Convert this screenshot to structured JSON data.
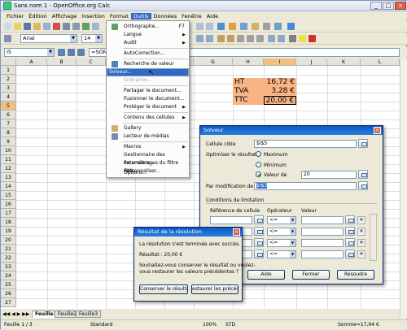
{
  "window": {
    "title": "Sans nom 1 - OpenOffice.org Calc"
  },
  "menubar": [
    "Fichier",
    "Édition",
    "Affichage",
    "Insertion",
    "Format",
    "Outils",
    "Données",
    "Fenêtre",
    "Aide"
  ],
  "toolbar": {
    "font_name": "Arial",
    "font_size": "14",
    "cell_ref": "I5",
    "formula_text": "=SOMM"
  },
  "columns": [
    "A",
    "B",
    "C",
    "D",
    "E",
    "F",
    "G",
    "H",
    "I",
    "J",
    "K",
    "L"
  ],
  "rows": [
    "1",
    "2",
    "3",
    "4",
    "5",
    "6",
    "7",
    "8",
    "9",
    "10",
    "11",
    "12",
    "13",
    "14",
    "15",
    "16",
    "17",
    "18",
    "19",
    "20",
    "21",
    "22",
    "23",
    "24",
    "25",
    "26",
    "27"
  ],
  "cells": {
    "h3": "HT",
    "i3": "16,72 €",
    "h4": "TVA",
    "i4": "3,28 €",
    "h5": "TTC",
    "i5": "20,00 €"
  },
  "outils_menu": {
    "orthographe": "Orthographe...",
    "orthographe_shortcut": "F7",
    "langue": "Langue",
    "audit": "Audit",
    "autocorrection": "AutoCorrection...",
    "recherche": "Recherche de valeur cible...",
    "solveur": "Solveur...",
    "scenarios": "Scénarios...",
    "partager": "Partager le document...",
    "fusionner": "Fusionner le document...",
    "proteger": "Protéger le document",
    "contenu": "Contenu des cellules",
    "gallery": "Gallery",
    "lecteur": "Lecteur de médias",
    "macros": "Macros",
    "gestionnaire": "Gestionnaire des extensions...",
    "parametrages": "Paramétrages du filtre XML...",
    "personnaliser": "Personnaliser...",
    "options": "Options..."
  },
  "solveur_dialog": {
    "title": "Solveur",
    "cellule_cible_label": "Cellule cible",
    "cellule_cible_value": "$I$5",
    "optimiser_label": "Optimiser le résultat à",
    "maximum": "Maximum",
    "minimum": "Minimum",
    "valeur_de": "Valeur de",
    "valeur_value": "20",
    "par_modification": "Par modification de cel",
    "par_modification_value": "$I$3",
    "conditions_label": "Conditions de limitation",
    "reference_col": "Référence de cellule",
    "operateur_col": "Opérateur",
    "valeur_col": "Valeur",
    "operator_value": "<=",
    "aide": "Aide",
    "fermer": "Fermer",
    "resoudre": "Résoudre"
  },
  "result_dialog": {
    "title": "Résultat de la résolution",
    "message": "La résolution s'est terminée avec succès.",
    "resultat": "Résultat : 20,00 €",
    "question_line1": "Souhaitez-vous conserver le résultat ou voulez-",
    "question_line2": "vous restaurer les valeurs précédentes ?",
    "conserver": "Conserver le résultat",
    "restaurer": "estaurer les précédent"
  },
  "sheet_tabs": [
    "Feuille1",
    "Feuille2",
    "Feuille3"
  ],
  "status": {
    "sheet": "Feuille 1 / 3",
    "style": "Standard",
    "zoom": "100%",
    "mode": "STD",
    "sum": "Somme=17,94 €"
  }
}
